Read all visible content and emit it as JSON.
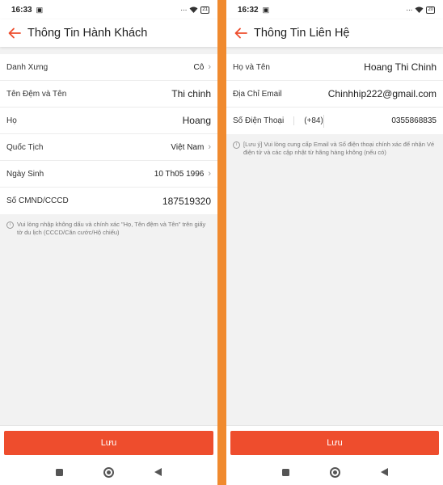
{
  "colors": {
    "accent": "#ee4d2d",
    "divider": "#f08a2e"
  },
  "left": {
    "status": {
      "time": "16:33",
      "battery": "21"
    },
    "title": "Thông Tin Hành Khách",
    "rows": [
      {
        "label": "Danh Xưng",
        "value": "Cô"
      },
      {
        "label": "Tên Đệm và Tên",
        "value": "Thi chinh"
      },
      {
        "label": "Họ",
        "value": "Hoang"
      },
      {
        "label": "Quốc Tịch",
        "value": "Việt Nam"
      },
      {
        "label": "Ngày Sinh",
        "value": "10 Th05 1996"
      },
      {
        "label": "Số CMND/CCCD",
        "value": "187519320"
      }
    ],
    "note": "Vui lòng nhập không dấu và chính xác \"Họ, Tên đệm và Tên\" trên giấy tờ du lịch (CCCD/Căn cước/Hộ chiếu)",
    "save_label": "Lưu"
  },
  "right": {
    "status": {
      "time": "16:32",
      "battery": "20"
    },
    "title": "Thông Tin Liên Hệ",
    "rows": [
      {
        "label": "Họ và Tên",
        "value": "Hoang Thi Chinh"
      },
      {
        "label": "Địa Chỉ Email",
        "value": "Chinhhip222@gmail.com"
      }
    ],
    "phone": {
      "label": "Số Điện Thoại",
      "code": "(+84)",
      "number": "0355868835"
    },
    "note": "[Lưu ý] Vui lòng cung cấp Email và Số điện thoại chính xác để nhận Vé điện tử và các cập nhật từ hãng hàng không (nếu có)",
    "save_label": "Lưu"
  }
}
